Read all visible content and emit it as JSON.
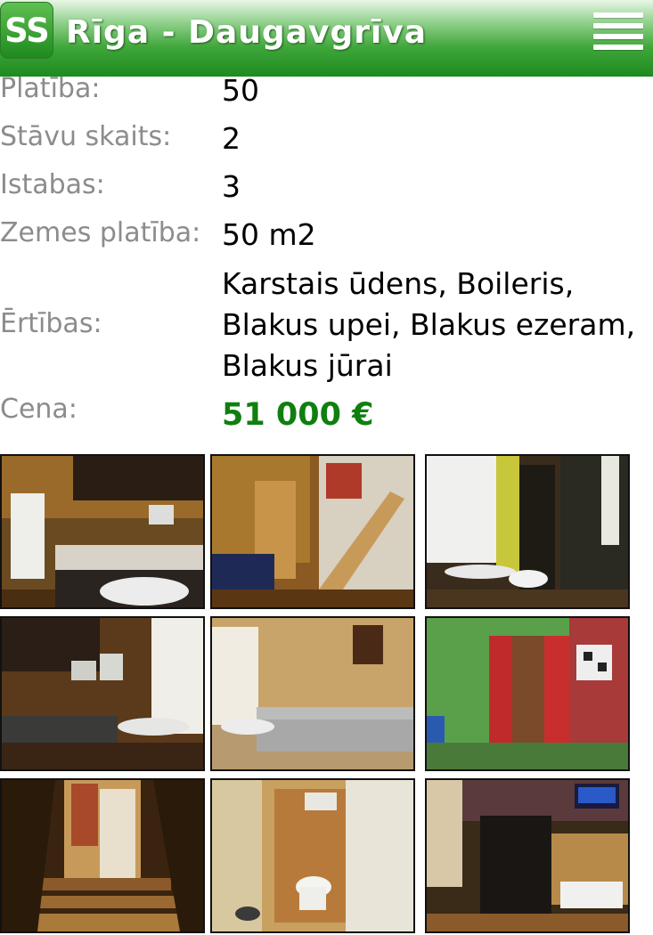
{
  "header": {
    "logo_text": "SS",
    "title": "Rīga - Daugavgrīva",
    "menu_icon": "hamburger-menu-icon",
    "colors": {
      "header_top": "#e8f6e6",
      "header_bottom": "#1d8a1f",
      "price": "#0f7f0f",
      "label": "#8c8c8c"
    }
  },
  "details": [
    {
      "label": "Platība:",
      "value": "50"
    },
    {
      "label": "Stāvu skaits:",
      "value": "2"
    },
    {
      "label": "Istabas:",
      "value": "3"
    },
    {
      "label": "Zemes platība:",
      "value": "50 m2"
    },
    {
      "label": "Ērtības:",
      "value": "Karstais ūdens, Boileris, Blakus upei, Blakus ezeram, Blakus jūrai"
    },
    {
      "label": "Cena:",
      "value": "51 000 €"
    }
  ],
  "photos": [
    {
      "name": "photo-kitchen"
    },
    {
      "name": "photo-living-stairs"
    },
    {
      "name": "photo-window-room"
    },
    {
      "name": "photo-kitchen-corner"
    },
    {
      "name": "photo-sofa-room"
    },
    {
      "name": "photo-shower"
    },
    {
      "name": "photo-staircase"
    },
    {
      "name": "photo-toilet"
    },
    {
      "name": "photo-tv-room"
    }
  ]
}
